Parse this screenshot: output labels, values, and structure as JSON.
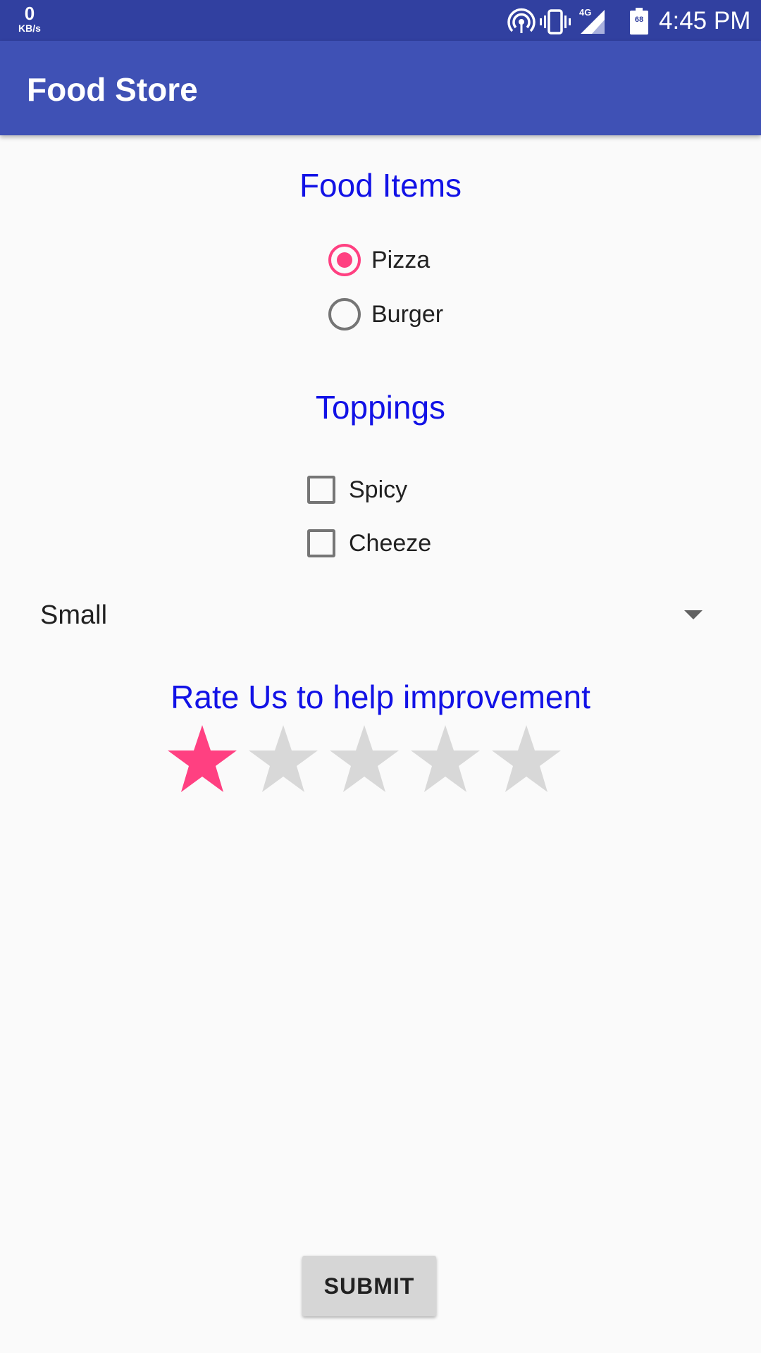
{
  "status_bar": {
    "net_speed_value": "0",
    "net_speed_unit": "KB/s",
    "network_type": "4G",
    "battery_level": "68",
    "time": "4:45 PM",
    "icons": [
      "hotspot-icon",
      "vibrate-icon",
      "signal-icon",
      "battery-icon"
    ]
  },
  "app_bar": {
    "title": "Food Store"
  },
  "food_section": {
    "heading": "Food Items",
    "options": [
      {
        "label": "Pizza",
        "checked": true
      },
      {
        "label": "Burger",
        "checked": false
      }
    ]
  },
  "toppings_section": {
    "heading": "Toppings",
    "options": [
      {
        "label": "Spicy",
        "checked": false
      },
      {
        "label": "Cheeze",
        "checked": false
      }
    ]
  },
  "size_spinner": {
    "selected": "Small"
  },
  "rating_section": {
    "heading": "Rate Us to help improvement",
    "rating": 1,
    "max_rating": 5
  },
  "submit_button": {
    "label": "SUBMIT"
  },
  "colors": {
    "status_bar": "#3140a0",
    "app_bar": "#3f51b5",
    "accent": "#ff4081",
    "heading": "#1212e6",
    "star_empty": "#d8d8d8",
    "control_unchecked": "#757575",
    "background": "#fafafa",
    "button": "#d6d6d6"
  }
}
